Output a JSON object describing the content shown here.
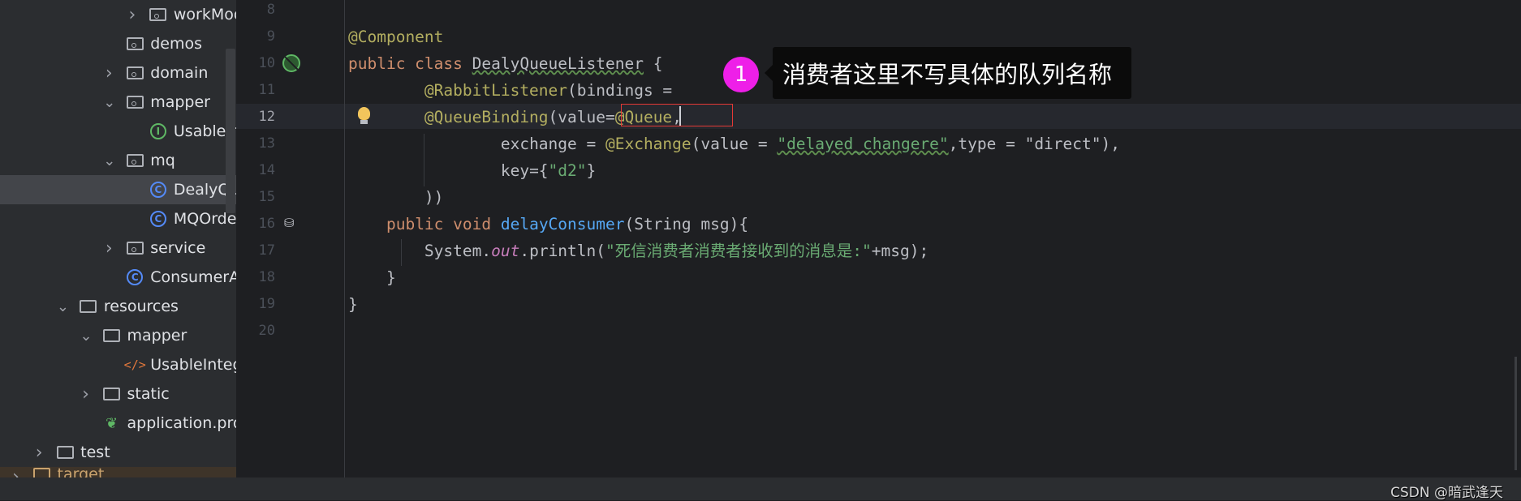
{
  "project_tree": [
    {
      "label": "workMod",
      "icon": "package-folder-icon",
      "chevron": "right",
      "indent": 3
    },
    {
      "label": "demos",
      "icon": "package-folder-icon",
      "chevron": "",
      "indent": 2
    },
    {
      "label": "domain",
      "icon": "package-folder-icon",
      "chevron": "right",
      "indent": 2
    },
    {
      "label": "mapper",
      "icon": "package-folder-icon",
      "chevron": "down",
      "indent": 2
    },
    {
      "label": "UsableIn",
      "icon": "interface-icon",
      "chevron": "",
      "indent": 3
    },
    {
      "label": "mq",
      "icon": "package-folder-icon",
      "chevron": "down",
      "indent": 2
    },
    {
      "label": "DealyQu",
      "icon": "class-icon",
      "chevron": "",
      "indent": 3,
      "selected": true
    },
    {
      "label": "MQOrde",
      "icon": "class-icon",
      "chevron": "",
      "indent": 3
    },
    {
      "label": "service",
      "icon": "package-folder-icon",
      "chevron": "right",
      "indent": 2
    },
    {
      "label": "ConsumerA",
      "icon": "spring-boot-class-icon",
      "chevron": "",
      "indent": 2
    },
    {
      "label": "resources",
      "icon": "resources-folder-icon",
      "chevron": "down",
      "indent": 0
    },
    {
      "label": "mapper",
      "icon": "folder-icon",
      "chevron": "down",
      "indent": 1
    },
    {
      "label": "UsableInteg",
      "icon": "xml-file-icon",
      "chevron": "",
      "indent": 2
    },
    {
      "label": "static",
      "icon": "folder-icon",
      "chevron": "right",
      "indent": 1
    },
    {
      "label": "application.pro",
      "icon": "spring-properties-icon",
      "chevron": "",
      "indent": 1
    },
    {
      "label": "test",
      "icon": "folder-icon",
      "chevron": "right",
      "indent": -1
    },
    {
      "label": "target",
      "icon": "excluded-folder-icon",
      "chevron": "right",
      "indent": -2
    }
  ],
  "editor": {
    "line_numbers": [
      "8",
      "9",
      "10",
      "11",
      "12",
      "13",
      "14",
      "15",
      "16",
      "17",
      "18",
      "19",
      "20"
    ],
    "current_line": "12",
    "lines": [
      [],
      [
        {
          "t": "@Component",
          "k": "ann"
        }
      ],
      [
        {
          "t": "public class ",
          "k": "kw"
        },
        {
          "t": "DealyQueueListener",
          "k": "plain sq"
        },
        {
          "t": " {",
          "k": "plain"
        }
      ],
      [
        {
          "t": "        "
        },
        {
          "t": "@RabbitListener",
          "k": "ann"
        },
        {
          "t": "(bindings =",
          "k": "plain"
        }
      ],
      [
        {
          "t": "        "
        },
        {
          "t": "@QueueBinding",
          "k": "ann"
        },
        {
          "t": "(value=",
          "k": "plain"
        },
        {
          "t": "@Queue",
          "k": "ann"
        },
        {
          "t": ",",
          "k": "plain"
        }
      ],
      [
        {
          "t": "                "
        },
        {
          "t": "exchange = ",
          "k": "plain"
        },
        {
          "t": "@Exchange",
          "k": "ann"
        },
        {
          "t": "(value = ",
          "k": "plain"
        },
        {
          "t": "\"delayed_changere\"",
          "k": "str sq"
        },
        {
          "t": ",type = ",
          "k": "plain"
        },
        {
          "t": "\"direct\"",
          "k": "plain"
        },
        {
          "t": "),",
          "k": "plain"
        }
      ],
      [
        {
          "t": "                "
        },
        {
          "t": "key={",
          "k": "plain"
        },
        {
          "t": "\"d2\"",
          "k": "str"
        },
        {
          "t": "}",
          "k": "plain"
        }
      ],
      [
        {
          "t": "        "
        },
        {
          "t": "))",
          "k": "plain"
        }
      ],
      [
        {
          "t": "    "
        },
        {
          "t": "public void ",
          "k": "kw"
        },
        {
          "t": "delayConsumer",
          "k": "fn"
        },
        {
          "t": "(String msg){",
          "k": "plain"
        }
      ],
      [
        {
          "t": "        "
        },
        {
          "t": "System.",
          "k": "plain"
        },
        {
          "t": "out",
          "k": "stat"
        },
        {
          "t": ".println(",
          "k": "plain"
        },
        {
          "t": "\"死信消费者消费者接收到的消息是:\"",
          "k": "str"
        },
        {
          "t": "+msg);",
          "k": "plain"
        }
      ],
      [
        {
          "t": "    "
        },
        {
          "t": "}",
          "k": "plain"
        }
      ],
      [
        {
          "t": "}",
          "k": "plain"
        }
      ],
      []
    ]
  },
  "annotation": {
    "number": "1",
    "text": "消费者这里不写具体的队列名称",
    "badge_color": "#ee1fe8",
    "box_color": "#e53935"
  },
  "watermark": "CSDN @暗武逢天"
}
